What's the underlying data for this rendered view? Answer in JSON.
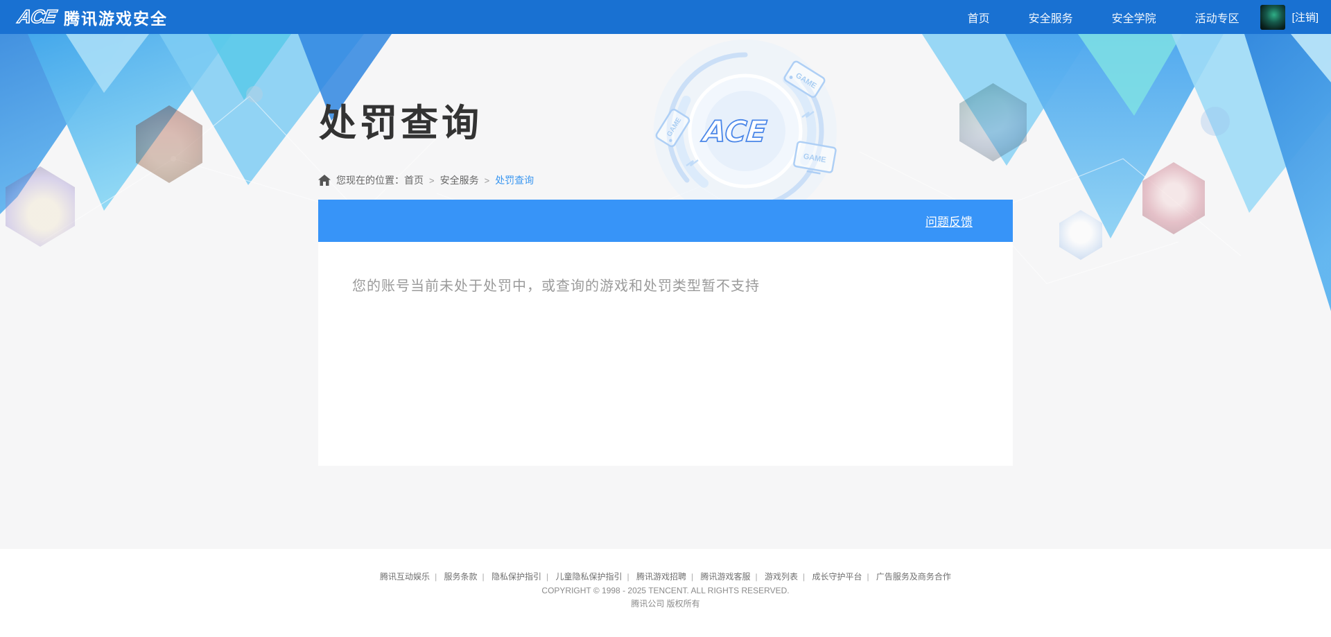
{
  "navbar": {
    "logo_mark": "ACE",
    "logo_text": "腾讯游戏安全",
    "items": [
      {
        "label": "首页"
      },
      {
        "label": "安全服务"
      },
      {
        "label": "安全学院"
      },
      {
        "label": "活动专区"
      }
    ],
    "logout_label": "[注销]"
  },
  "banner": {
    "title": "处罚查询",
    "breadcrumb": {
      "prefix": "您现在的位置：",
      "separator": ">",
      "items": [
        "首页",
        "安全服务",
        "处罚查询"
      ]
    },
    "emblem_text": "ACE",
    "game_tag_label": "GAME"
  },
  "card": {
    "feedback_link": "问题反馈",
    "message": "您的账号当前未处于处罚中，或查询的游戏和处罚类型暂不支持"
  },
  "footer": {
    "separator": "|",
    "links": [
      "腾讯互动娱乐",
      "服务条款",
      "隐私保护指引",
      "儿童隐私保护指引",
      "腾讯游戏招聘",
      "腾讯游戏客服",
      "游戏列表",
      "成长守护平台",
      "广告服务及商务合作"
    ],
    "copyright": "COPYRIGHT © 1998 - 2025 TENCENT. ALL RIGHTS RESERVED.",
    "company": "腾讯公司 版权所有"
  },
  "colors": {
    "navbar_blue": "#1971d2",
    "card_bar_blue": "#3794f8",
    "breadcrumb_active": "#3b97f0",
    "page_bg": "#f6f6f7"
  }
}
